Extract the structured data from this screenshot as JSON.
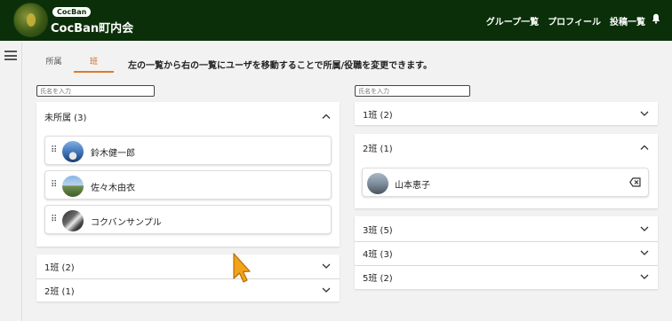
{
  "header": {
    "badge": "CocBan",
    "title": "CocBan町内会",
    "nav": [
      "グループ一覧",
      "プロフィール",
      "投稿一覧"
    ],
    "bar_color": "#0b3009"
  },
  "tabs": [
    {
      "label": "所属",
      "active": false
    },
    {
      "label": "班",
      "active": true
    }
  ],
  "instruction": "左の一覧から右の一覧にユーザを移動することで所属/役職を変更できます。",
  "left": {
    "search_placeholder": "氏名を入力",
    "groups": [
      {
        "label": "未所属 (3)",
        "expanded": true,
        "members": [
          {
            "name": "鈴木健一郎"
          },
          {
            "name": "佐々木由衣"
          },
          {
            "name": "コクバンサンプル"
          }
        ]
      },
      {
        "label": "1班 (2)",
        "expanded": false
      },
      {
        "label": "2班 (1)",
        "expanded": false
      }
    ]
  },
  "right": {
    "search_placeholder": "氏名を入力",
    "groups": [
      {
        "label": "1班 (2)",
        "expanded": false
      },
      {
        "label": "2班 (1)",
        "expanded": true,
        "members": [
          {
            "name": "山本恵子"
          }
        ]
      },
      {
        "label": "3班 (5)",
        "expanded": false
      },
      {
        "label": "4班 (3)",
        "expanded": false
      },
      {
        "label": "5班 (2)",
        "expanded": false
      }
    ]
  },
  "accent_color": "#e07a2a"
}
